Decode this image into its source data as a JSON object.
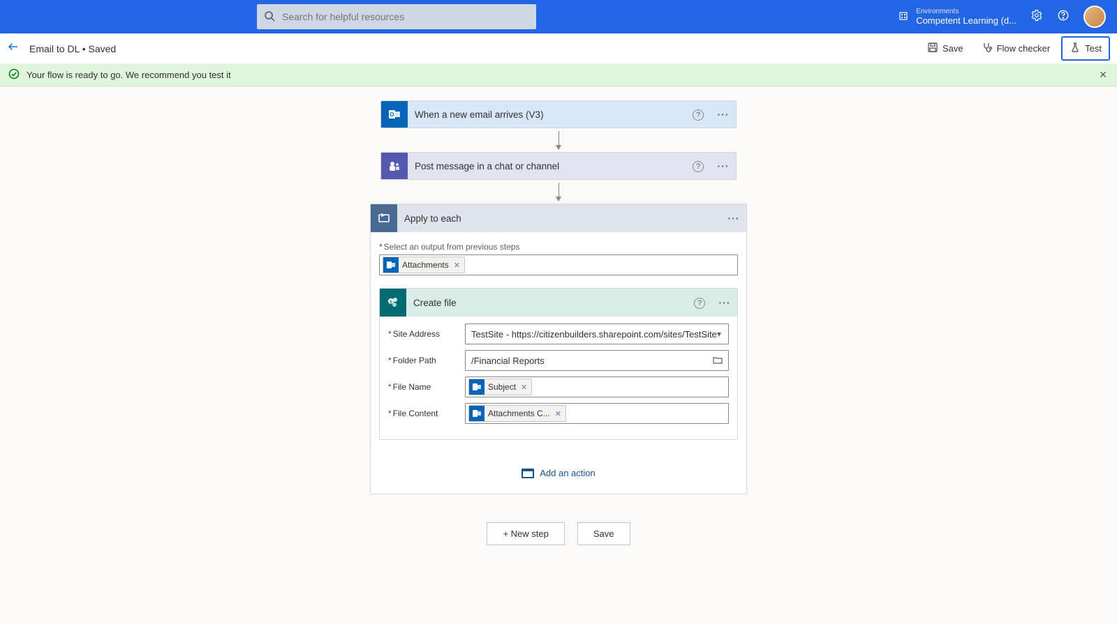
{
  "topbar": {
    "search_placeholder": "Search for helpful resources",
    "env_label": "Environments",
    "env_name": "Competent Learning (d..."
  },
  "subheader": {
    "breadcrumb": "Email to DL • Saved",
    "save": "Save",
    "flow_checker": "Flow checker",
    "test": "Test"
  },
  "notify": {
    "text": "Your flow is ready to go. We recommend you test it"
  },
  "steps": {
    "trigger_title": "When a new email arrives (V3)",
    "teams_title": "Post message in a chat or channel",
    "foreach_title": "Apply to each",
    "foreach_field_label": "Select an output from previous steps",
    "foreach_token": "Attachments",
    "createfile_title": "Create file",
    "fields": {
      "site_label": "Site Address",
      "site_value": "TestSite - https://citizenbuilders.sharepoint.com/sites/TestSite",
      "folder_label": "Folder Path",
      "folder_value": "/Financial Reports",
      "filename_label": "File Name",
      "filename_token": "Subject",
      "filecontent_label": "File Content",
      "filecontent_token": "Attachments C..."
    },
    "add_action": "Add an action"
  },
  "footer": {
    "new_step": "+ New step",
    "save": "Save"
  }
}
